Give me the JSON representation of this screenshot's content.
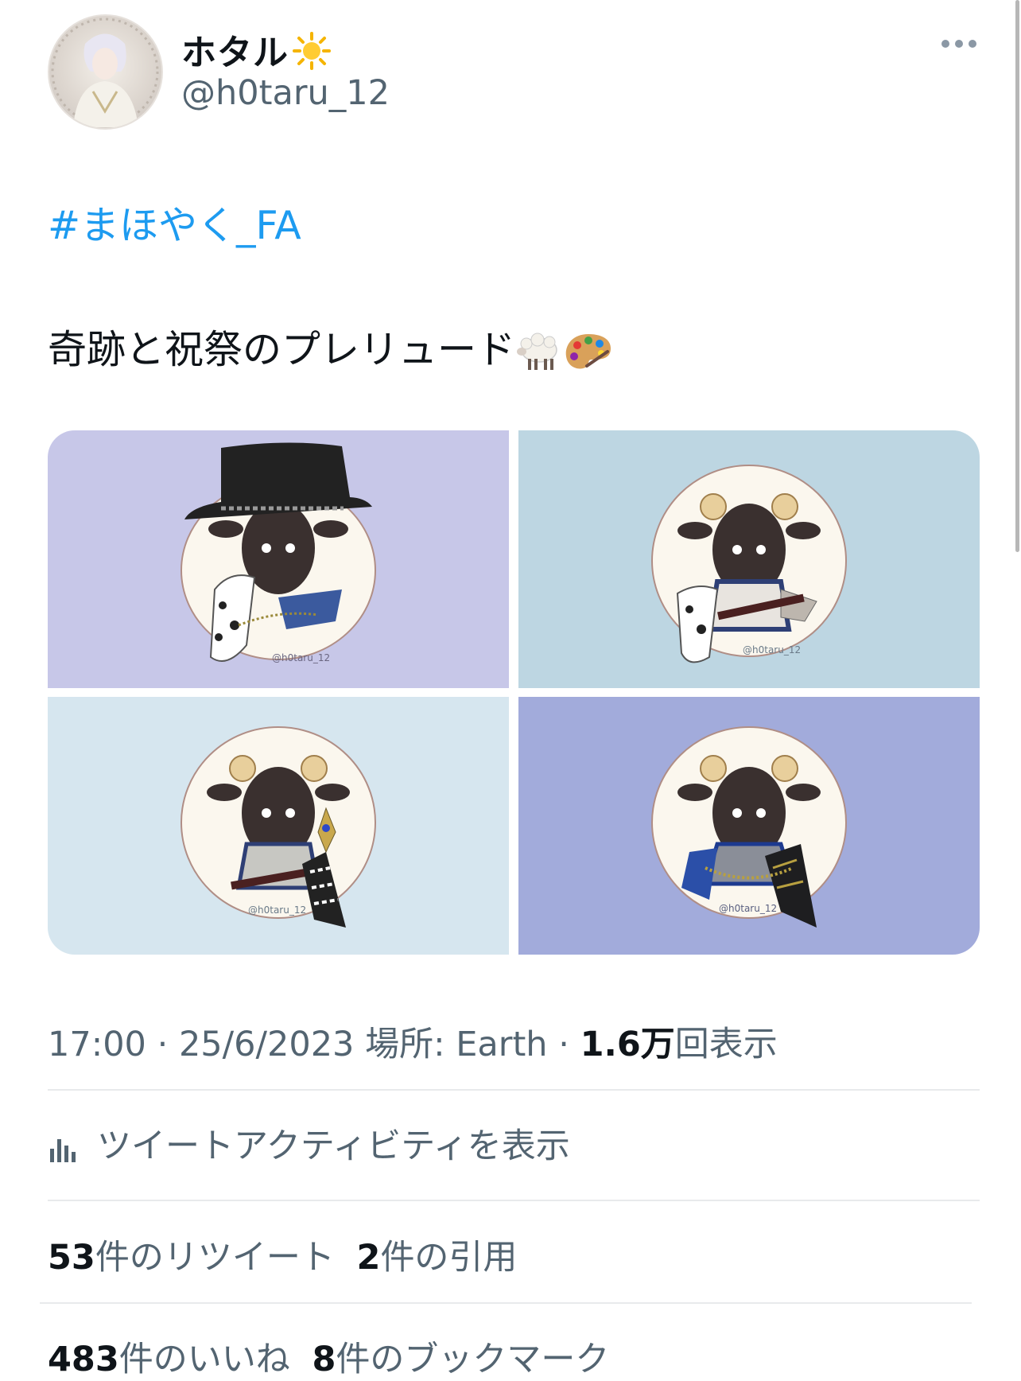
{
  "user": {
    "display_name": "ホタル",
    "name_emoji": "sun-emoji",
    "handle": "@h0taru_12"
  },
  "tweet": {
    "hashtag": "#まほやく_FA",
    "text": "奇跡と祝祭のプレリュード",
    "emojis": [
      "sheep-emoji",
      "palette-emoji"
    ],
    "images": [
      {
        "background": "#c7c7e8",
        "watermark": "@h0taru_12"
      },
      {
        "background": "#bdd6e2",
        "watermark": "@h0taru_12"
      },
      {
        "background": "#d6e6ef",
        "watermark": "@h0taru_12"
      },
      {
        "background": "#a2abdb",
        "watermark": "@h0taru_12"
      }
    ]
  },
  "meta": {
    "time": "17:00",
    "date": "25/6/2023",
    "location_label": "場所: Earth",
    "views_count": "1.6万",
    "views_label": "回表示",
    "separator": "·"
  },
  "activity": {
    "label": "ツイートアクティビティを表示"
  },
  "stats": {
    "retweets_count": "53",
    "retweets_label": "件のリツイート",
    "quotes_count": "2",
    "quotes_label": "件の引用",
    "likes_count": "483",
    "likes_label": "件のいいね",
    "bookmarks_count": "8",
    "bookmarks_label": "件のブックマーク"
  },
  "colors": {
    "link": "#1d9bf0",
    "secondary_text": "#536471",
    "primary_text": "#0f1419",
    "divider": "#e8eaec"
  }
}
